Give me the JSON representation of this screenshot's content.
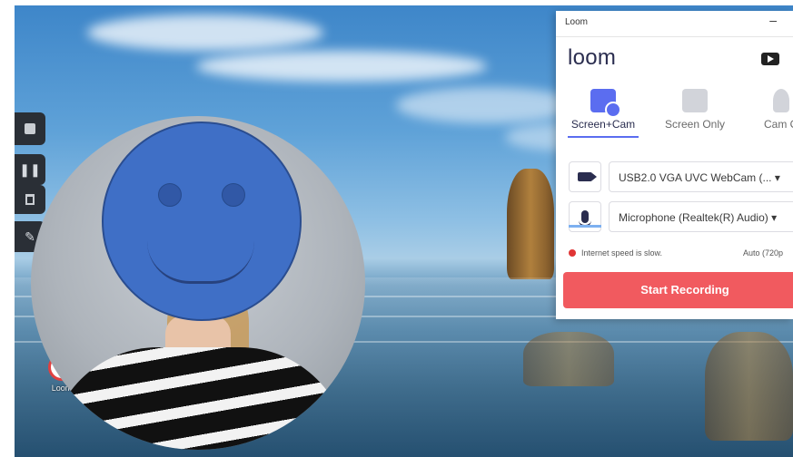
{
  "desktop": {
    "icon_label": "Loom"
  },
  "toolbar": {
    "stop_icon": "stop-icon",
    "pause_icon": "pause-icon",
    "delete_icon": "trash-icon",
    "draw_icon": "pencil-icon"
  },
  "loom": {
    "window_title": "Loom",
    "minimize": "–",
    "brand": "loom",
    "modes": [
      {
        "label": "Screen+Cam",
        "selected": true
      },
      {
        "label": "Screen Only",
        "selected": false
      },
      {
        "label": "Cam O",
        "selected": false
      }
    ],
    "camera_select": "USB2.0 VGA UVC WebCam (... ▾",
    "mic_select": "Microphone (Realtek(R) Audio) ▾",
    "status_text": "Internet speed is slow.",
    "quality": "Auto (720p",
    "start_label": "Start Recording",
    "accent": "#5b6df0",
    "record_color": "#f15a5f"
  }
}
